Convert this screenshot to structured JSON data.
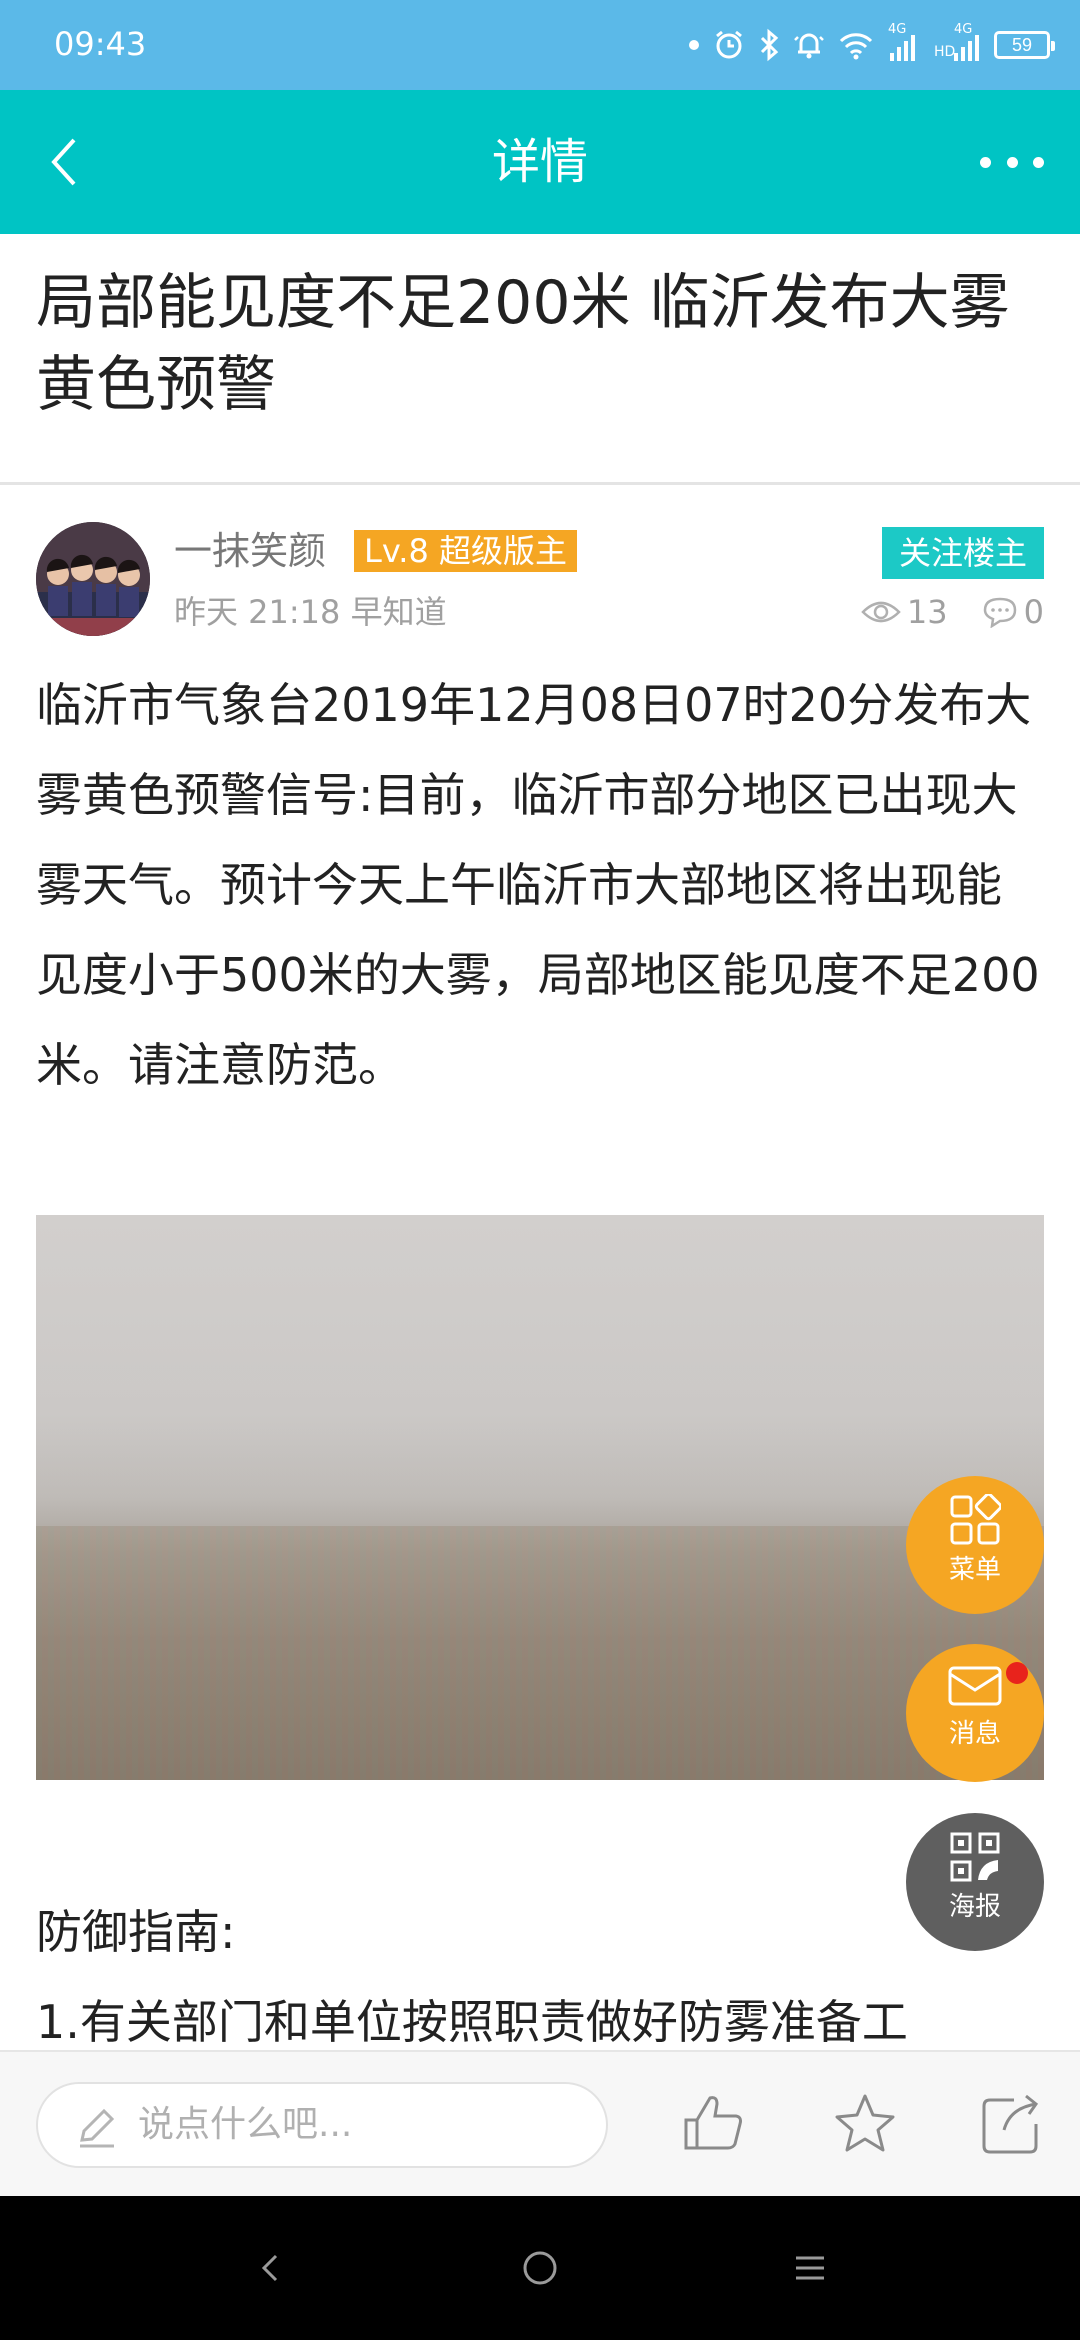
{
  "status_bar": {
    "time": "09:43",
    "battery": "59",
    "net_4g_1": "4G",
    "net_hd": "HD",
    "net_4g_2": "4G"
  },
  "header": {
    "title": "详情"
  },
  "post": {
    "title": "局部能见度不足200米 临沂发布大雾黄色预警",
    "author": "一抹笑颜",
    "level_badge": "Lv.8 超级版主",
    "follow_label": "关注楼主",
    "meta": "昨天 21:18 早知道",
    "views": "13",
    "comments": "0",
    "body": "临沂市气象台2019年12月08日07时20分发布大雾黄色预警信号:目前，临沂市部分地区已出现大雾天气。预计今天上午临沂市大部地区将出现能见度小于500米的大雾，局部地区能见度不足200米。请注意防范。",
    "guide_heading": "防御指南:",
    "guide_item_1": "1.有关部门和单位按照职责做好防雾准备工"
  },
  "fabs": {
    "menu_label": "菜单",
    "message_label": "消息",
    "poster_label": "海报"
  },
  "bottom_bar": {
    "comment_placeholder": "说点什么吧..."
  },
  "colors": {
    "status_bar": "#5bb9e8",
    "header": "#00c4c4",
    "follow_button": "#1cc9c6",
    "level_badge": "#f5a623",
    "fab_orange": "#f5a623",
    "fab_poster": "#5f5f5f",
    "notification_dot": "#e8231c"
  }
}
